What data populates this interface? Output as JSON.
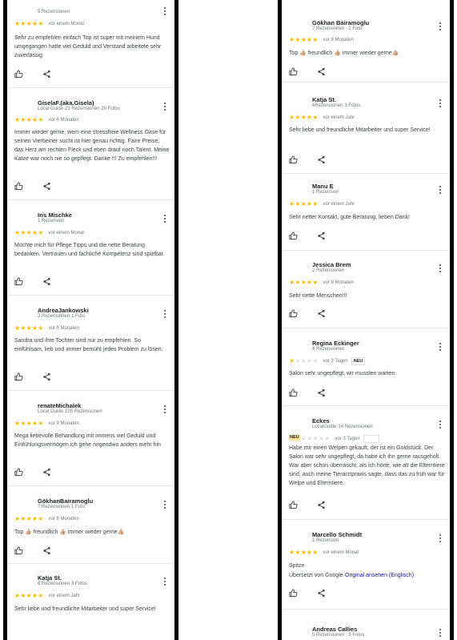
{
  "left": [
    {
      "name": "",
      "meta": "5 Rezensionen",
      "rating": 5,
      "date": "vor einem Monat",
      "text": "Sehr zu empfehlen einfach Top ist super mit meinem Hund umgegangen hatte viel Geduld und Verstand arbeitete sehr zuverlässig"
    },
    {
      "name": "GiselaF.(aka.Gisela)",
      "meta": "Local Guide·23 Rezensionen·20 Fotos",
      "rating": 5,
      "date": "vor 6 Monaten",
      "text": "Immer wieder gerne, wem eine stressfreie Wellness Oase für seinen Vierbeiner sucht ist hier genau richtig. Faire Preise, das Herz am rechten Fleck und eben drauf noch Talent. Meine Katze war noch nie so gepflegt. Danke !!! Zu empfehlen!!!"
    },
    {
      "name": "Iris Mischke",
      "meta": "1 Rezension",
      "rating": 5,
      "date": "vor einem Monat",
      "text": "Möchte mich für Pflege Tipps und die nette Beratung bedanken. Vertrauen und fachliche Kompetenz sind spürbar."
    },
    {
      "name": "AndreaJankowski",
      "meta": "2 Rezensionen·1 Foto",
      "rating": 5,
      "date": "vor 5 Monaten",
      "text": "Sandra und ihre Tochter sind nur zu empfehlen. So einfühlsam, lieb und immer bemüht jedes Problem zu lösen."
    },
    {
      "name": "renateMichalek",
      "meta": "Local Guide·105 Rezensionen",
      "rating": 5,
      "date": "vor 9 Monaten",
      "text": "Mega liebevolle Behandlung mit immens viel Geduld und Einfühlungsvermögen ich gehe nirgendwo anders mehr hin"
    },
    {
      "name": "GökhanBairamoglu",
      "meta": "7 Rezensionen·1 Foto",
      "rating": 5,
      "date": "vor 8 Monaten",
      "text": "Top 👍🏼 freundlich 👍🏼 immer wieder gerne👍🏼"
    },
    {
      "name": "Katja St.",
      "meta": "6 Rezensionen·3 Fotos",
      "rating": 5,
      "date": "vor einem Jahr",
      "text": "Sehr liebe und freundliche Mitarbeiter und super Service!"
    }
  ],
  "right": [
    {
      "name": "Gökhan Bairamoglu",
      "meta": "7 Rezensionen · 1 Foto",
      "rating": 5,
      "date": "vor 8 Monaten",
      "text": "Top 👍🏼 freundlich 👍🏼 immer wieder gerne👍🏼"
    },
    {
      "name": "Katja St.",
      "meta": "6Rezensionen·3 Fotos",
      "rating": 5,
      "date": "vor einem Jahr",
      "text": "Sehr liebe und freundliche Mitarbeiter und super Service!"
    },
    {
      "name": "Manu E",
      "meta": "1 Rezension",
      "rating": 5,
      "date": "vor einem Jahr",
      "text": "Sehr netter Kontakt, gute Beratung, lieben Dank!"
    },
    {
      "name": "Jessica Brem",
      "meta": "2 Rezensionen",
      "rating": 5,
      "date": "vor 9 Monaten",
      "text": "Sehr nette Menschen!!!"
    },
    {
      "name": "Regina Eckinger",
      "meta": "6 Rezensionen",
      "rating": 1,
      "date": "vor 3 Tagen",
      "badge": "NEU",
      "text": "Salon sehr ungepflegt, wir mussten warten."
    },
    {
      "name": "Eckes",
      "meta": "LocalGuide·14 Rezensionen",
      "rating": 0,
      "date": "vor 3 Tagen",
      "badge_left": "NEU",
      "text": "Habe mir einen Welpen gekauft, der ist ein Goldstück. Der Salon war sehr ungepflegt, da habe ich ihn gerne rausgeholt. War aber schon überrascht, als ich hörte, wie alt die Elterntiere sind, auch meine Tierarztpraxis sagte, dass das zu früh war für Welpe und Elterntiere."
    },
    {
      "name": "Marcello Schmidt",
      "meta": "1 Rezension",
      "rating": 5,
      "date": "vor einem Monat",
      "text": "Spitze",
      "translated_prefix": "Übersetzt von Google·",
      "translated_link": "Original ansehen (Englisch)"
    },
    {
      "name": "Andreas Callies",
      "meta": "5 Rezensionen · 5 Fotos",
      "rating": 5,
      "date": "",
      "text": ""
    }
  ]
}
